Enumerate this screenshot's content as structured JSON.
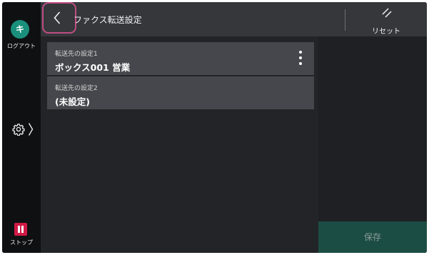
{
  "rail": {
    "avatar_initial": "キ",
    "logout_label": "ログアウト",
    "stop_label": "ストップ"
  },
  "header": {
    "title": "ファクス転送設定",
    "reset_label": "リセット"
  },
  "list": {
    "items": [
      {
        "caption": "転送先の設定1",
        "value": "ボックス001 営業"
      },
      {
        "caption": "転送先の設定2",
        "value": "(未設定)"
      }
    ]
  },
  "footer": {
    "save_label": "保存"
  },
  "colors": {
    "avatar": "#1a8f7c",
    "stop": "#d11a47",
    "back_highlight": "#c04d83",
    "save_disabled_bg": "#1c4d45"
  },
  "icons": [
    "back-chevron-icon",
    "reset-icon",
    "gear-icon",
    "chevron-right-icon",
    "more-vertical-icon",
    "stop-icon"
  ]
}
